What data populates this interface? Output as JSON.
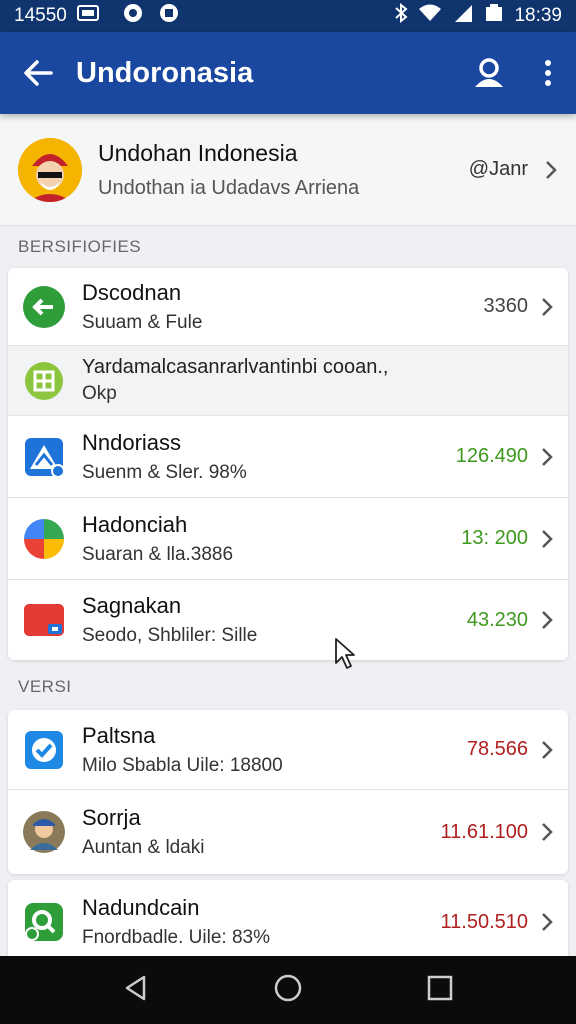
{
  "status": {
    "time_left": "14550",
    "time_right": "18:39",
    "icons": [
      "sim-icon",
      "circle-notification-icon",
      "storage-icon",
      "bluetooth-icon",
      "wifi-icon",
      "signal-icon",
      "battery-icon"
    ]
  },
  "appbar": {
    "title": "Undoronasia",
    "color": "#1a47a0"
  },
  "profile": {
    "name": "Undohan Indonesia",
    "subtitle": "Undothan ia Udadavs Arriena",
    "handle": "@Janr"
  },
  "sections": [
    {
      "header": "BERSIFIOFIES",
      "rows": [
        {
          "title": "Dscodnan",
          "subtitle": "Suuam & Fule",
          "value": "3360",
          "value_color": "#444444",
          "icon": "green-exchange-icon"
        },
        {
          "title": "Yardamalcasanrarlvantinbi cooan.,",
          "subtitle": "Okp",
          "note": true,
          "icon": "calendar-app-icon"
        },
        {
          "title": "Nndoriass",
          "subtitle": "Suenm & Sler. 98%",
          "value": "126.490",
          "value_color": "#3e9a1e",
          "icon": "chart-app-icon"
        },
        {
          "title": "Hadonciah",
          "subtitle": "Suaran & lla.3886",
          "value": "13: 200",
          "value_color": "#3e9a1e",
          "icon": "pie-app-icon"
        },
        {
          "title": "Sagnakan",
          "subtitle": "Seodo, Shbliler: Sille",
          "value": "43.230",
          "value_color": "#3e9a1e",
          "icon": "red-folder-icon"
        }
      ]
    },
    {
      "header": "VERSI",
      "rows": [
        {
          "title": "Paltsna",
          "subtitle": "Milo Sbabla Uile: 18800",
          "value": "78.566",
          "value_color": "#b02020",
          "icon": "blue-check-icon"
        },
        {
          "title": "Sorrja",
          "subtitle": "Auntan & ldaki",
          "value": "11.61.100",
          "value_color": "#b02020",
          "icon": "person-avatar-icon"
        },
        {
          "title": "Nadundcain",
          "subtitle": "Fnordbadle. Uile: 83%",
          "value": "11.50.510",
          "value_color": "#b02020",
          "icon": "green-search-icon"
        }
      ]
    }
  ]
}
